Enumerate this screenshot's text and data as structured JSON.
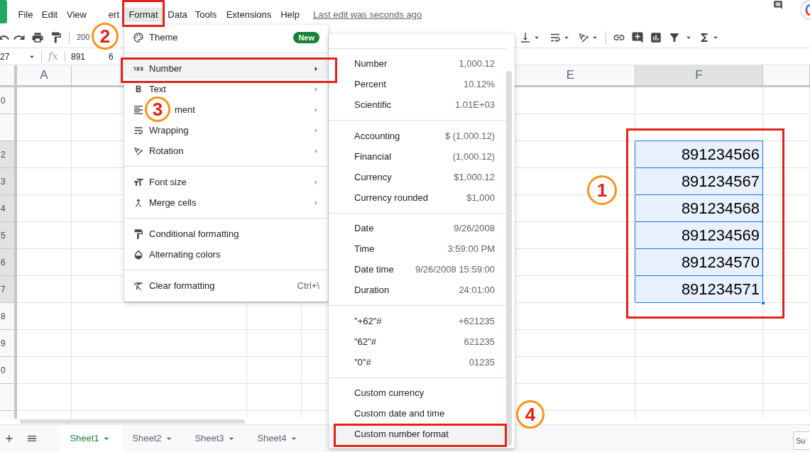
{
  "menu_bar": {
    "items": [
      {
        "label": "File",
        "selected": false
      },
      {
        "label": "Edit",
        "selected": false
      },
      {
        "label": "View",
        "selected": false
      },
      {
        "label": "ert",
        "selected": false
      },
      {
        "label": "Format",
        "selected": true
      },
      {
        "label": "Data",
        "selected": false
      },
      {
        "label": "Tools",
        "selected": false
      },
      {
        "label": "Extensions",
        "selected": false
      },
      {
        "label": "Help",
        "selected": false
      }
    ],
    "last_edit": "Last edit was seconds ago"
  },
  "toolbar": {
    "zoom": "200"
  },
  "formula_bar": {
    "cell_ref": "27",
    "fx": "fx",
    "value_parts": [
      "891",
      "6"
    ]
  },
  "grid": {
    "columns": [
      {
        "label": "A",
        "selected": false
      },
      {
        "label": "E",
        "selected": false
      },
      {
        "label": "F",
        "selected": true
      }
    ],
    "rows": [
      {
        "label": "0",
        "selected": false
      },
      {
        "selected": false
      },
      {
        "label": "2",
        "selected": true,
        "value": "891234566"
      },
      {
        "label": "3",
        "selected": true,
        "value": "891234567"
      },
      {
        "label": "4",
        "selected": true,
        "value": "891234568"
      },
      {
        "label": "5",
        "selected": true,
        "value": "891234569"
      },
      {
        "label": "6",
        "selected": true,
        "value": "891234570"
      },
      {
        "label": "7",
        "selected": true,
        "value": "891234571"
      },
      {
        "label": "8",
        "selected": false
      },
      {
        "label": "9",
        "selected": false
      },
      {
        "label": "0",
        "selected": false
      },
      {
        "selected": false
      }
    ]
  },
  "format_menu": {
    "items": [
      {
        "kind": "item",
        "label": "Theme",
        "badge": "New",
        "selected": false
      },
      {
        "kind": "divider"
      },
      {
        "kind": "submenu",
        "label": "Number",
        "selected": true
      },
      {
        "kind": "submenu",
        "label": "Text",
        "selected": false
      },
      {
        "kind": "submenu",
        "label": "ment",
        "selected": false
      },
      {
        "kind": "submenu",
        "label": "Wrapping",
        "selected": false
      },
      {
        "kind": "submenu",
        "label": "Rotation",
        "selected": false
      },
      {
        "kind": "divider"
      },
      {
        "kind": "submenu",
        "label": "Font size",
        "selected": false
      },
      {
        "kind": "submenu",
        "label": "Merge cells",
        "selected": false
      },
      {
        "kind": "divider"
      },
      {
        "kind": "item",
        "label": "Conditional formatting",
        "selected": false
      },
      {
        "kind": "item",
        "label": "Alternating colors",
        "selected": false
      },
      {
        "kind": "divider"
      },
      {
        "kind": "item",
        "label": "Clear formatting",
        "shortcut": "Ctrl+\\",
        "selected": false
      }
    ]
  },
  "number_submenu": {
    "items": [
      {
        "kind": "divider"
      },
      {
        "kind": "option",
        "label": "Number",
        "value": "1,000.12",
        "selected": false
      },
      {
        "kind": "option",
        "label": "Percent",
        "value": "10.12%",
        "selected": false
      },
      {
        "kind": "option",
        "label": "Scientific",
        "value": "1.01E+03",
        "selected": false
      },
      {
        "kind": "divider"
      },
      {
        "kind": "option",
        "label": "Accounting",
        "value": "$ (1,000.12)",
        "selected": false
      },
      {
        "kind": "option",
        "label": "Financial",
        "value": "(1,000.12)",
        "selected": false
      },
      {
        "kind": "option",
        "label": "Currency",
        "value": "$1,000.12",
        "selected": false
      },
      {
        "kind": "option",
        "label": "Currency rounded",
        "value": "$1,000",
        "selected": false
      },
      {
        "kind": "divider"
      },
      {
        "kind": "option",
        "label": "Date",
        "value": "9/26/2008",
        "selected": false
      },
      {
        "kind": "option",
        "label": "Time",
        "value": "3:59:00 PM",
        "selected": false
      },
      {
        "kind": "option",
        "label": "Date time",
        "value": "9/26/2008 15:59:00",
        "selected": false
      },
      {
        "kind": "option",
        "label": "Duration",
        "value": "24:01:00",
        "selected": false
      },
      {
        "kind": "divider"
      },
      {
        "kind": "option",
        "label": "\"+62\"#",
        "value": "+621235",
        "selected": false
      },
      {
        "kind": "option",
        "label": "\"62\"#",
        "value": "621235",
        "selected": false
      },
      {
        "kind": "option",
        "label": "\"0\"#",
        "value": "01235",
        "selected": false
      },
      {
        "kind": "divider"
      },
      {
        "kind": "custom",
        "label": "Custom currency",
        "selected": false
      },
      {
        "kind": "custom",
        "label": "Custom date and time",
        "selected": false
      },
      {
        "kind": "custom",
        "label": "Custom number format",
        "selected": true
      }
    ]
  },
  "sheet_tabs": [
    {
      "label": "Sheet1",
      "selected": true
    },
    {
      "label": "Sheet2",
      "selected": false
    },
    {
      "label": "Sheet3",
      "selected": false
    },
    {
      "label": "Sheet4",
      "selected": false
    }
  ],
  "status_bar": {
    "sum": "Su"
  },
  "callouts": [
    {
      "label": "1"
    },
    {
      "label": "2"
    },
    {
      "label": "3"
    },
    {
      "label": "4"
    }
  ]
}
